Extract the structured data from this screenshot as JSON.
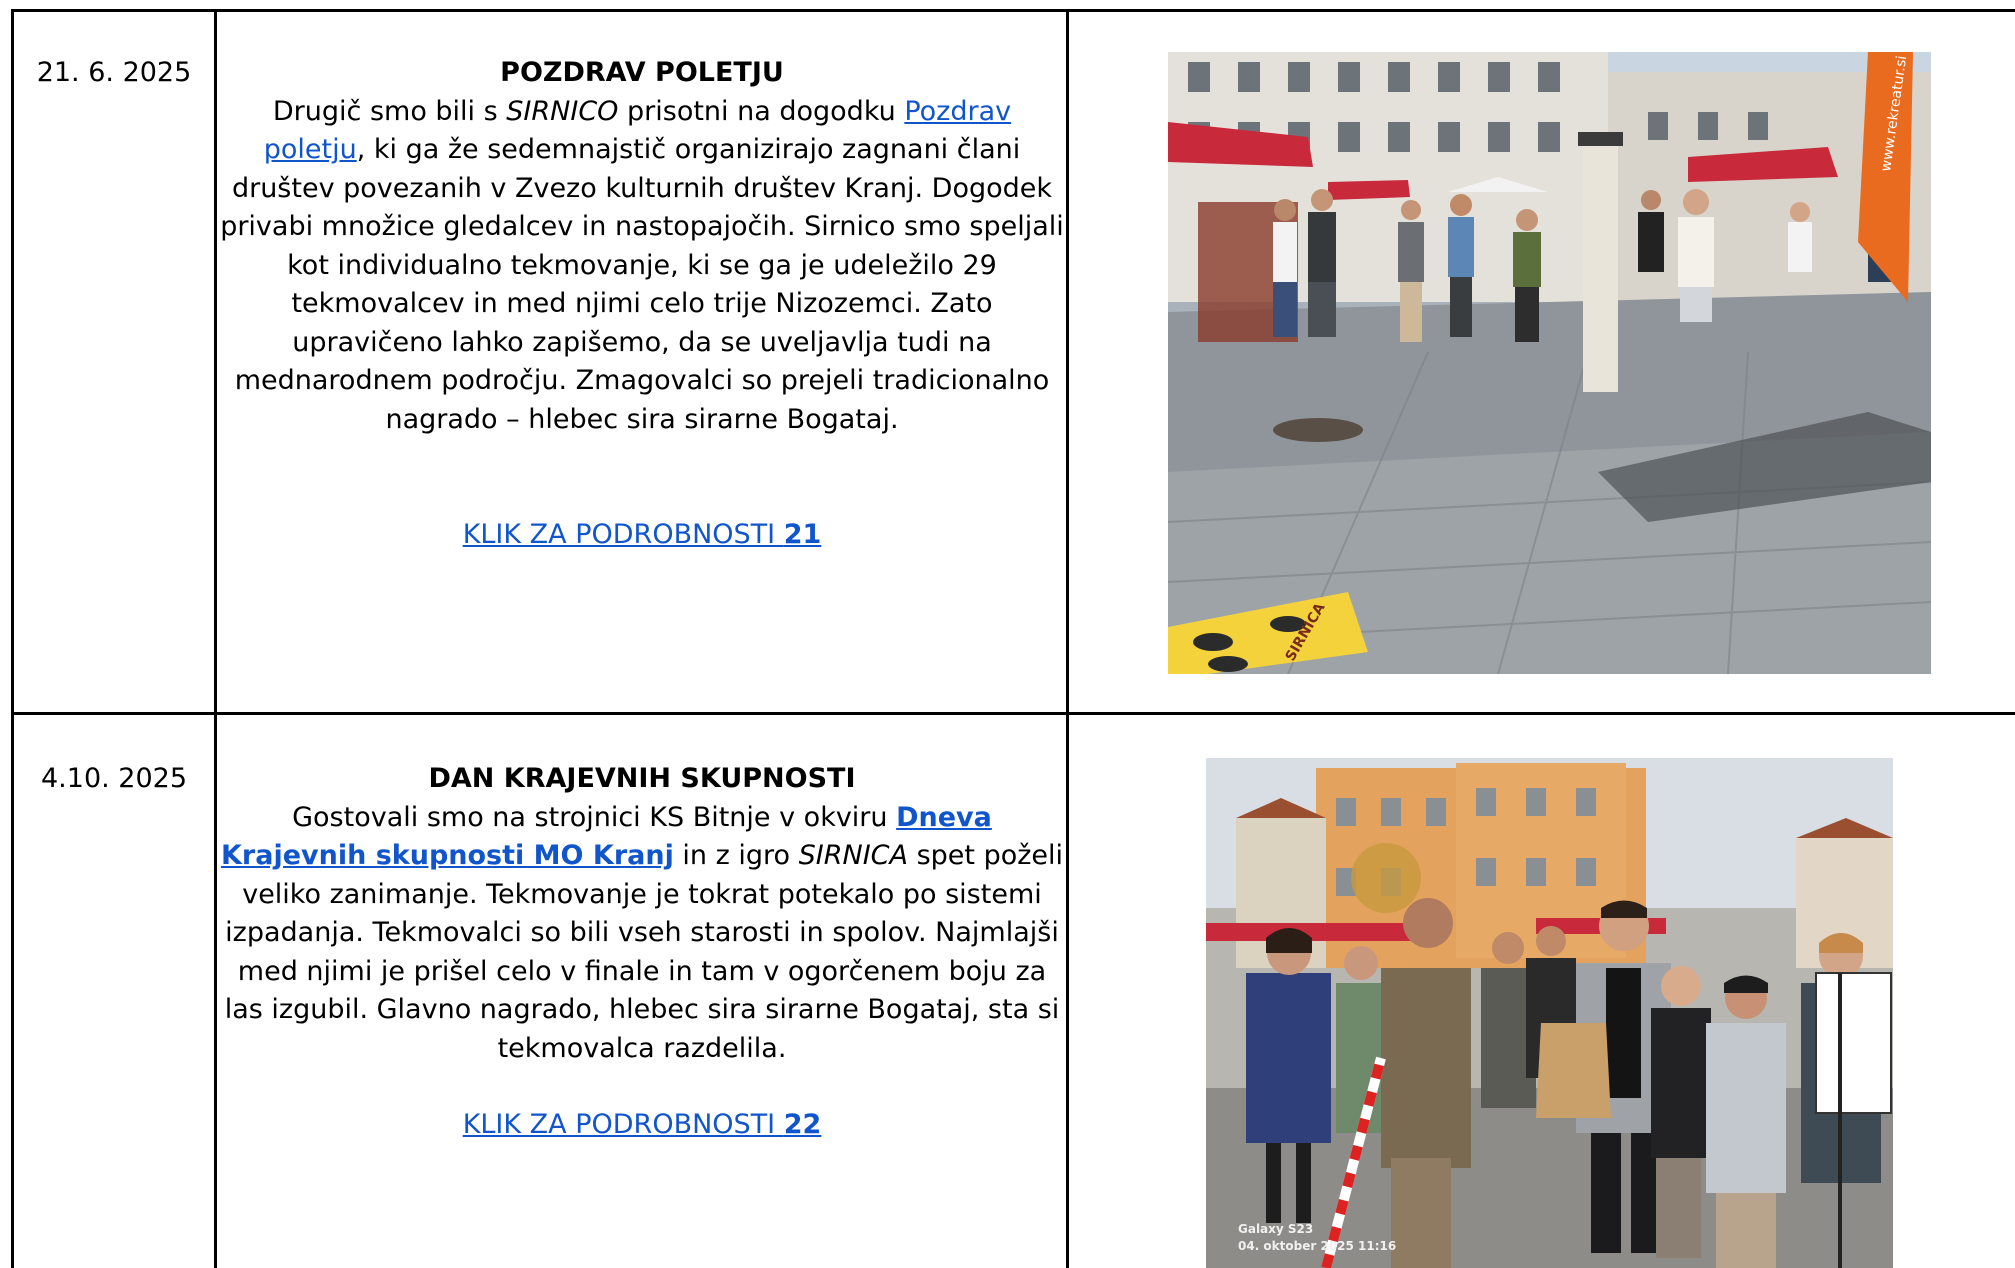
{
  "rows": [
    {
      "date": "21. 6. 2025",
      "title": "POZDRAV POLETJU",
      "p1": "Drugič smo bili s ",
      "p1_italic": "SIRNICO",
      "p1_b": " prisotni na dogodku ",
      "p1_link": "Pozdrav poletju",
      "p1_c": ", ki ga že sedemnajstič organizirajo zagnani člani društev povezanih v Zvezo kulturnih društev Kranj. Dogodek privabi množice gledalcev in nastopajočih. Sirnico smo speljali kot individualno tekmovanje, ki se ga je udeležilo 29 tekmovalcev in med njimi celo trije Nizozemci. Zato upravičeno lahko zapišemo, da se uveljavlja tudi na mednarodnem področju. Zmagovalci so prejeli tradicionalno nagrado – hlebec sira sirarne Bogataj.",
      "details_text": "KLIK ZA PODROBNOSTI ",
      "details_num": "21",
      "photo": {
        "banner_text": "www.rekreatur.si",
        "game_text": "SIRNICA"
      }
    },
    {
      "date": "4.10. 2025",
      "title": "DAN KRAJEVNIH SKUPNOSTI",
      "p1": "Gostovali smo na strojnici KS Bitnje v okviru  ",
      "p1_link": "Dneva Krajevnih skupnosti MO Kranj",
      "p1_b": " in z igro ",
      "p1_italic": "SIRNICA",
      "p1_c": " spet poželi veliko zanimanje. Tekmovanje je tokrat potekalo po sistemi izpadanja.  Tekmovalci so bili vseh starosti in spolov. Najmlajši med njimi je prišel celo v finale in tam v ogorčenem boju za las izgubil. Glavno nagrado, hlebec sira sirarne Bogataj, sta si tekmovalca razdelila.",
      "details_text": "KLIK ZA PODROBNOSTI ",
      "details_num": "22",
      "photo": {
        "watermark_device": "Galaxy S23",
        "watermark_date": "04. oktober 2025 11:16"
      }
    }
  ]
}
